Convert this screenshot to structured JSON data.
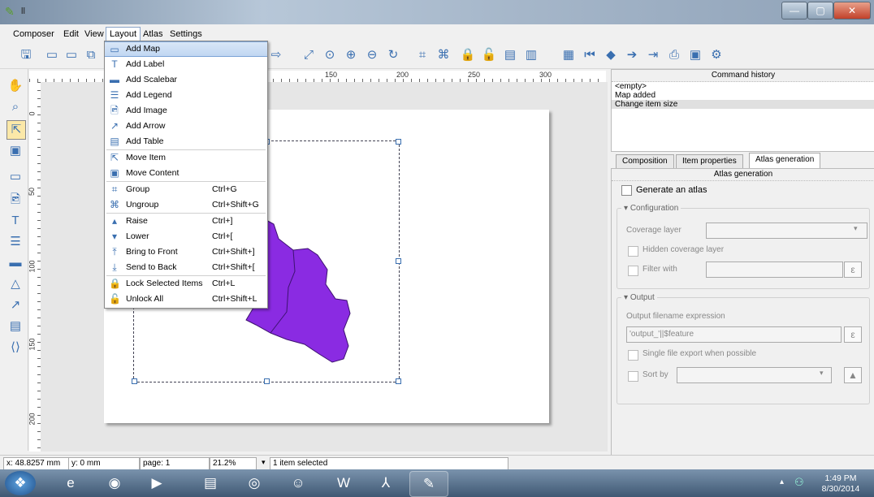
{
  "menubar": {
    "items": [
      "Composer",
      "Edit",
      "View",
      "Layout",
      "Atlas",
      "Settings"
    ]
  },
  "layout_menu": {
    "items": [
      {
        "label": "Add Map",
        "shortcut": "",
        "icon": "add-map-icon"
      },
      {
        "label": "Add Label",
        "shortcut": "",
        "icon": "add-label-icon"
      },
      {
        "label": "Add Scalebar",
        "shortcut": "",
        "icon": "add-scalebar-icon"
      },
      {
        "label": "Add Legend",
        "shortcut": "",
        "icon": "add-legend-icon"
      },
      {
        "label": "Add Image",
        "shortcut": "",
        "icon": "add-image-icon"
      },
      {
        "label": "Add Arrow",
        "shortcut": "",
        "icon": "add-arrow-icon"
      },
      {
        "label": "Add Table",
        "shortcut": "",
        "icon": "add-table-icon"
      },
      {
        "label": "Move Item",
        "shortcut": "",
        "icon": "move-item-icon"
      },
      {
        "label": "Move Content",
        "shortcut": "",
        "icon": "move-content-icon"
      },
      {
        "label": "Group",
        "shortcut": "Ctrl+G",
        "icon": "group-icon"
      },
      {
        "label": "Ungroup",
        "shortcut": "Ctrl+Shift+G",
        "icon": "ungroup-icon"
      },
      {
        "label": "Raise",
        "shortcut": "Ctrl+]",
        "icon": "raise-icon"
      },
      {
        "label": "Lower",
        "shortcut": "Ctrl+[",
        "icon": "lower-icon"
      },
      {
        "label": "Bring to Front",
        "shortcut": "Ctrl+Shift+]",
        "icon": "bring-to-front-icon"
      },
      {
        "label": "Send to Back",
        "shortcut": "Ctrl+Shift+[",
        "icon": "send-to-back-icon"
      },
      {
        "label": "Lock Selected Items",
        "shortcut": "Ctrl+L",
        "icon": "lock-icon"
      },
      {
        "label": "Unlock All",
        "shortcut": "Ctrl+Shift+L",
        "icon": "unlock-icon"
      }
    ]
  },
  "ruler": {
    "top_ticks": [
      "150",
      "200",
      "250",
      "300"
    ],
    "left_ticks": [
      "0",
      "50",
      "100",
      "150",
      "200"
    ]
  },
  "command_history": {
    "title": "Command history",
    "items": [
      "<empty>",
      "Map added",
      "Change item size"
    ]
  },
  "tabs": [
    "Composition",
    "Item properties",
    "Atlas generation"
  ],
  "atlas": {
    "panel_title": "Atlas generation",
    "generate_label": "Generate an atlas",
    "configuration_title": "Configuration",
    "coverage_layer_label": "Coverage layer",
    "hidden_coverage_label": "Hidden coverage layer",
    "filter_with_label": "Filter with",
    "output_title": "Output",
    "output_filename_label": "Output filename expression",
    "output_filename_value": "'output_'||$feature",
    "single_file_label": "Single file export when possible",
    "sort_by_label": "Sort by"
  },
  "statusbar": {
    "x": "x: 48.8257 mm",
    "y": "y: 0 mm",
    "page": "page: 1",
    "zoom": "21.2%",
    "selection": "1 item selected"
  },
  "clock": {
    "time": "1:49 PM",
    "date": "8/30/2014"
  },
  "colors": {
    "map_fill": "#8a2be2",
    "selection": "#3a6fb0"
  }
}
